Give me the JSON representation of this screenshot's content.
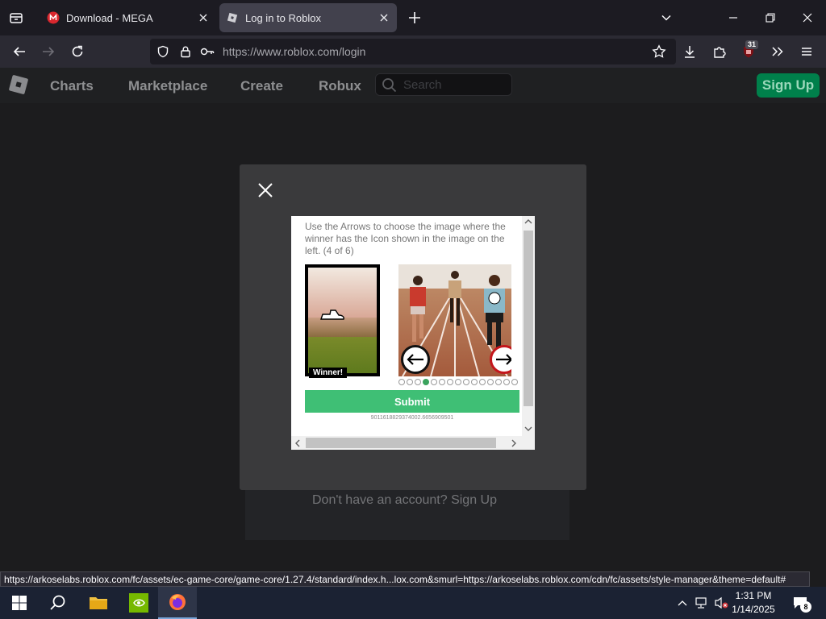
{
  "browser": {
    "tabs": [
      {
        "title": "Download - MEGA",
        "active": false,
        "favicon": "mega-icon"
      },
      {
        "title": "Log in to Roblox",
        "active": true,
        "favicon": "roblox-icon"
      }
    ],
    "url_host": "https://www.roblox.com",
    "url_path": "/login",
    "extension_badge": "31",
    "status_url": "https://arkoselabs.roblox.com/fc/assets/ec-game-core/game-core/1.27.4/standard/index.h...lox.com&smurl=https://arkoselabs.roblox.com/cdn/fc/assets/style-manager&theme=default#"
  },
  "roblox": {
    "nav": [
      "Charts",
      "Marketplace",
      "Create",
      "Robux"
    ],
    "search_placeholder": "Search",
    "signup_label": "Sign Up",
    "no_account": "Don't have an account? Sign Up"
  },
  "captcha": {
    "instruction": "Use the Arrows to choose the image where the winner has the Icon shown in the image on the left. (4 of 6)",
    "winner_label": "Winner!",
    "submit_label": "Submit",
    "session_id": "9011618829374002.6656909501",
    "progress": {
      "total": 15,
      "current": 4
    }
  },
  "taskbar": {
    "time": "1:31 PM",
    "date": "1/14/2025",
    "notifications": "8"
  },
  "colors": {
    "roblox_green": "#00804b",
    "submit_green": "#3fbf75",
    "active_dot": "#3aa35d"
  }
}
